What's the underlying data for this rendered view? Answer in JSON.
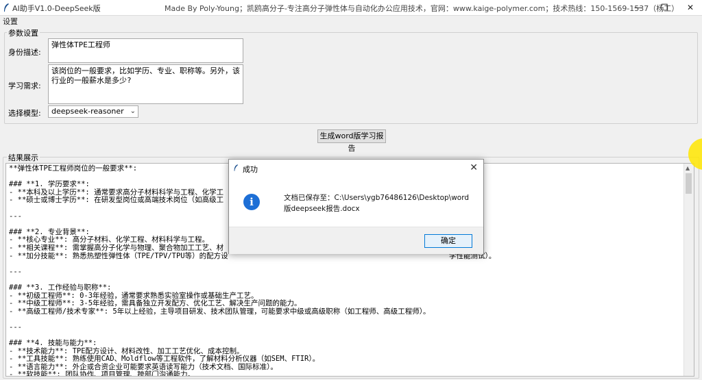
{
  "window": {
    "title": "AI助手V1.0-DeepSeek版",
    "credit": "Made By Poly-Young；凯鸥高分子-专注高分子弹性体与自动化办公应用技术，官网：www.kaige-polymer.com；技术热线：150-1569-1537（杨工）",
    "minimize": "—",
    "restore": "❐",
    "close": "✕"
  },
  "menu": {
    "settings": "设置"
  },
  "params": {
    "legend": "参数设置",
    "identity_label": "身份描述:",
    "identity_value": "弹性体TPE工程师",
    "learning_label": "学习需求:",
    "learning_value": "该岗位的一般要求，比如学历、专业、职称等。另外，该行业的一般薪水是多少?",
    "model_label": "选择模型:",
    "model_value": "deepseek-reasoner"
  },
  "generate_button": "生成word版学习报告",
  "results": {
    "legend": "结果展示",
    "text": "**弹性体TPE工程师岗位的一般要求**:\n\n### **1. 学历要求**:\n- **本科及以上学历**: 通常要求高分子材料科学与工程、化学工\n- **硕士或博士学历**: 在研发型岗位或高端技术岗位（如高级工\n\n---\n\n### **2. 专业背景**:\n- **核心专业**: 高分子材料、化学工程、材料科学与工程。\n- **相关课程**: 需掌握高分子化学与物理、聚合物加工工艺、材\n- **加分技能**: 熟悉热塑性弹性体（TPE/TPV/TPU等）的配方设                                                   学性能测试）。\n\n---\n\n### **3. 工作经验与职称**:\n- **初级工程师**: 0-3年经验，通常要求熟悉实验室操作或基础生产工艺。\n- **中级工程师**: 3-5年经验，需具备独立开发配方、优化工艺、解决生产问题的能力。\n- **高级工程师/技术专家**: 5年以上经验，主导项目研发、技术团队管理，可能要求中级或高级职称（如工程师、高级工程师）。\n\n---\n\n### **4. 技能与能力**:\n- **技术能力**: TPE配方设计、材料改性、加工工艺优化、成本控制。\n- **工具技能**: 熟练使用CAD、Moldflow等工程软件，了解材料分析仪器（如SEM、FTIR）。\n- **语言能力**: 外企或合资企业可能要求英语读写能力（技术文档、国际标准）。\n- **软技能**: 团队协作、项目管理、跨部门沟通能力。\n\n---"
  },
  "dialog": {
    "title": "成功",
    "close": "✕",
    "info_glyph": "i",
    "message": "文档已保存至：C:\\Users\\ygb76486126\\Desktop\\word版deepseek报告.docx",
    "ok": "确定"
  },
  "colors": {
    "info_blue": "#1d6fd6",
    "cursor_highlight": "#ffe600",
    "ok_border": "#0078d7"
  }
}
